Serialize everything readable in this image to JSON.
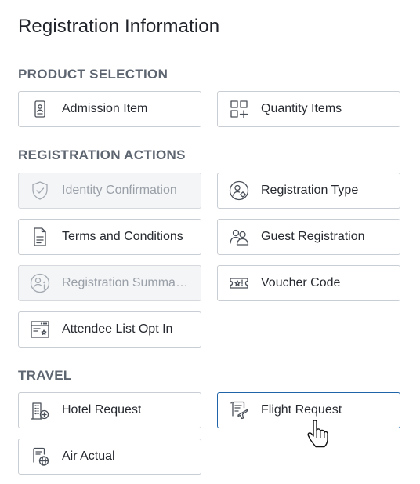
{
  "page": {
    "title": "Registration Information"
  },
  "sections": {
    "product": "PRODUCT SELECTION",
    "actions": "REGISTRATION ACTIONS",
    "travel": "TRAVEL"
  },
  "tiles": {
    "admission_item": {
      "label": "Admission Item",
      "icon": "admission-badge-icon",
      "disabled": false
    },
    "quantity_items": {
      "label": "Quantity Items",
      "icon": "grid-plus-icon",
      "disabled": false
    },
    "identity_confirmation": {
      "label": "Identity Confirmation",
      "icon": "shield-check-icon",
      "disabled": true
    },
    "registration_type": {
      "label": "Registration Type",
      "icon": "person-gear-icon",
      "disabled": false
    },
    "terms_and_conditions": {
      "label": "Terms and Conditions",
      "icon": "document-icon",
      "disabled": false
    },
    "guest_registration": {
      "label": "Guest Registration",
      "icon": "two-people-icon",
      "disabled": false
    },
    "registration_summary": {
      "label": "Registration Summa…",
      "icon": "person-info-icon",
      "disabled": true
    },
    "voucher_code": {
      "label": "Voucher Code",
      "icon": "ticket-star-icon",
      "disabled": false
    },
    "attendee_list_opt_in": {
      "label": "Attendee List Opt In",
      "icon": "browser-star-icon",
      "disabled": false
    },
    "hotel_request": {
      "label": "Hotel Request",
      "icon": "building-plus-icon",
      "disabled": false
    },
    "flight_request": {
      "label": "Flight Request",
      "icon": "document-plane-icon",
      "disabled": false,
      "hovered": true
    },
    "air_actual": {
      "label": "Air Actual",
      "icon": "document-globe-icon",
      "disabled": false
    }
  },
  "colors": {
    "hover_border": "#1f63a9",
    "section_label": "#5d6570",
    "disabled_bg": "#f4f5f7"
  }
}
